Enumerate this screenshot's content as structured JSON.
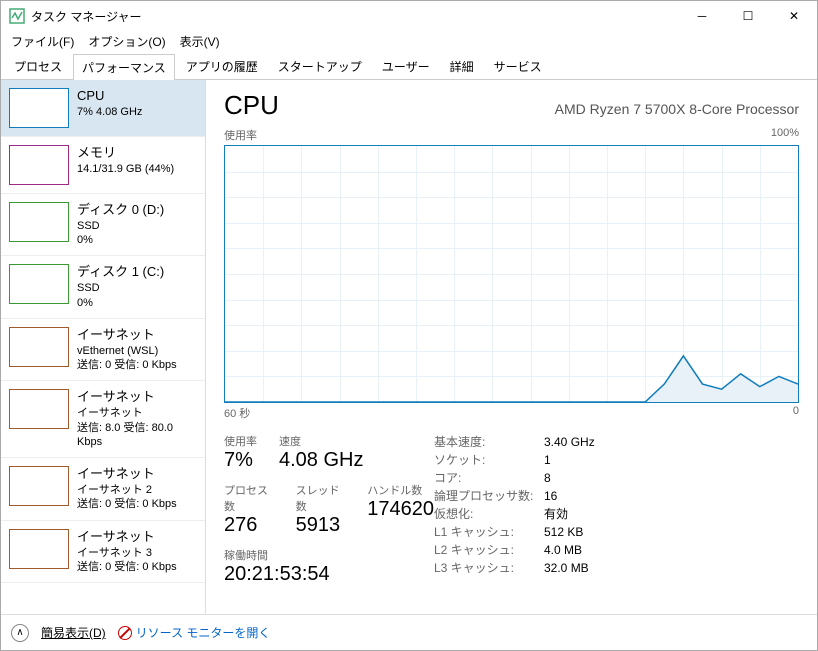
{
  "window": {
    "title": "タスク マネージャー"
  },
  "menu": {
    "file": "ファイル(F)",
    "options": "オプション(O)",
    "view": "表示(V)"
  },
  "tabs": [
    "プロセス",
    "パフォーマンス",
    "アプリの履歴",
    "スタートアップ",
    "ユーザー",
    "詳細",
    "サービス"
  ],
  "sidebar": [
    {
      "name": "CPU",
      "sub1": "7%  4.08 GHz",
      "sub2": "",
      "color": "#117dbb"
    },
    {
      "name": "メモリ",
      "sub1": "14.1/31.9 GB (44%)",
      "sub2": "",
      "color": "#9b2a8a"
    },
    {
      "name": "ディスク 0 (D:)",
      "sub1": "SSD",
      "sub2": "0%",
      "color": "#3a9b35"
    },
    {
      "name": "ディスク 1 (C:)",
      "sub1": "SSD",
      "sub2": "0%",
      "color": "#3a9b35"
    },
    {
      "name": "イーサネット",
      "sub1": "vEthernet (WSL)",
      "sub2": "送信: 0 受信: 0 Kbps",
      "color": "#a05a2c"
    },
    {
      "name": "イーサネット",
      "sub1": "イーサネット",
      "sub2": "送信: 8.0 受信: 80.0 Kbps",
      "color": "#a05a2c"
    },
    {
      "name": "イーサネット",
      "sub1": "イーサネット 2",
      "sub2": "送信: 0 受信: 0 Kbps",
      "color": "#a05a2c"
    },
    {
      "name": "イーサネット",
      "sub1": "イーサネット 3",
      "sub2": "送信: 0 受信: 0 Kbps",
      "color": "#a05a2c"
    }
  ],
  "main": {
    "title": "CPU",
    "model": "AMD Ryzen 7 5700X 8-Core Processor",
    "chart": {
      "topLeft": "使用率",
      "topRight": "100%",
      "botLeft": "60 秒",
      "botRight": "0"
    },
    "big": [
      {
        "lbl": "使用率",
        "val": "7%"
      },
      {
        "lbl": "速度",
        "val": "4.08 GHz"
      },
      {
        "lbl": "プロセス数",
        "val": "276"
      },
      {
        "lbl": "スレッド数",
        "val": "5913"
      },
      {
        "lbl": "ハンドル数",
        "val": "174620"
      },
      {
        "lbl": "稼働時間",
        "val": "20:21:53:54"
      }
    ],
    "right": [
      {
        "k": "基本速度:",
        "v": "3.40 GHz"
      },
      {
        "k": "ソケット:",
        "v": "1"
      },
      {
        "k": "コア:",
        "v": "8"
      },
      {
        "k": "論理プロセッサ数:",
        "v": "16"
      },
      {
        "k": "仮想化:",
        "v": "有効"
      },
      {
        "k": "L1 キャッシュ:",
        "v": "512 KB"
      },
      {
        "k": "L2 キャッシュ:",
        "v": "4.0 MB"
      },
      {
        "k": "L3 キャッシュ:",
        "v": "32.0 MB"
      }
    ]
  },
  "footer": {
    "fewer": "簡易表示(D)",
    "resmon": "リソース モニターを開く"
  },
  "chart_data": {
    "type": "line",
    "title": "使用率",
    "xlabel": "秒",
    "ylabel": "%",
    "xlim": [
      60,
      0
    ],
    "ylim": [
      0,
      100
    ],
    "x": [
      60,
      58,
      56,
      54,
      52,
      50,
      48,
      46,
      44,
      42,
      40,
      38,
      36,
      34,
      32,
      30,
      28,
      26,
      24,
      22,
      20,
      18,
      16,
      14,
      12,
      10,
      8,
      6,
      4,
      2,
      0
    ],
    "values": [
      0,
      0,
      0,
      0,
      0,
      0,
      0,
      0,
      0,
      0,
      0,
      0,
      0,
      0,
      0,
      0,
      0,
      0,
      0,
      0,
      0,
      0,
      0,
      7,
      18,
      7,
      5,
      11,
      6,
      10,
      7
    ]
  }
}
